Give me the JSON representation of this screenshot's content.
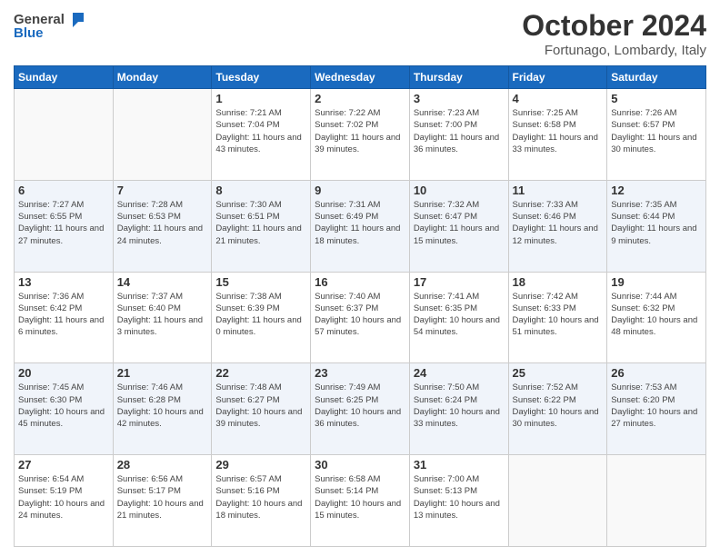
{
  "logo": {
    "general": "General",
    "blue": "Blue"
  },
  "title": "October 2024",
  "subtitle": "Fortunago, Lombardy, Italy",
  "weekdays": [
    "Sunday",
    "Monday",
    "Tuesday",
    "Wednesday",
    "Thursday",
    "Friday",
    "Saturday"
  ],
  "weeks": [
    [
      {
        "day": "",
        "info": ""
      },
      {
        "day": "",
        "info": ""
      },
      {
        "day": "1",
        "sunrise": "Sunrise: 7:21 AM",
        "sunset": "Sunset: 7:04 PM",
        "daylight": "Daylight: 11 hours and 43 minutes."
      },
      {
        "day": "2",
        "sunrise": "Sunrise: 7:22 AM",
        "sunset": "Sunset: 7:02 PM",
        "daylight": "Daylight: 11 hours and 39 minutes."
      },
      {
        "day": "3",
        "sunrise": "Sunrise: 7:23 AM",
        "sunset": "Sunset: 7:00 PM",
        "daylight": "Daylight: 11 hours and 36 minutes."
      },
      {
        "day": "4",
        "sunrise": "Sunrise: 7:25 AM",
        "sunset": "Sunset: 6:58 PM",
        "daylight": "Daylight: 11 hours and 33 minutes."
      },
      {
        "day": "5",
        "sunrise": "Sunrise: 7:26 AM",
        "sunset": "Sunset: 6:57 PM",
        "daylight": "Daylight: 11 hours and 30 minutes."
      }
    ],
    [
      {
        "day": "6",
        "sunrise": "Sunrise: 7:27 AM",
        "sunset": "Sunset: 6:55 PM",
        "daylight": "Daylight: 11 hours and 27 minutes."
      },
      {
        "day": "7",
        "sunrise": "Sunrise: 7:28 AM",
        "sunset": "Sunset: 6:53 PM",
        "daylight": "Daylight: 11 hours and 24 minutes."
      },
      {
        "day": "8",
        "sunrise": "Sunrise: 7:30 AM",
        "sunset": "Sunset: 6:51 PM",
        "daylight": "Daylight: 11 hours and 21 minutes."
      },
      {
        "day": "9",
        "sunrise": "Sunrise: 7:31 AM",
        "sunset": "Sunset: 6:49 PM",
        "daylight": "Daylight: 11 hours and 18 minutes."
      },
      {
        "day": "10",
        "sunrise": "Sunrise: 7:32 AM",
        "sunset": "Sunset: 6:47 PM",
        "daylight": "Daylight: 11 hours and 15 minutes."
      },
      {
        "day": "11",
        "sunrise": "Sunrise: 7:33 AM",
        "sunset": "Sunset: 6:46 PM",
        "daylight": "Daylight: 11 hours and 12 minutes."
      },
      {
        "day": "12",
        "sunrise": "Sunrise: 7:35 AM",
        "sunset": "Sunset: 6:44 PM",
        "daylight": "Daylight: 11 hours and 9 minutes."
      }
    ],
    [
      {
        "day": "13",
        "sunrise": "Sunrise: 7:36 AM",
        "sunset": "Sunset: 6:42 PM",
        "daylight": "Daylight: 11 hours and 6 minutes."
      },
      {
        "day": "14",
        "sunrise": "Sunrise: 7:37 AM",
        "sunset": "Sunset: 6:40 PM",
        "daylight": "Daylight: 11 hours and 3 minutes."
      },
      {
        "day": "15",
        "sunrise": "Sunrise: 7:38 AM",
        "sunset": "Sunset: 6:39 PM",
        "daylight": "Daylight: 11 hours and 0 minutes."
      },
      {
        "day": "16",
        "sunrise": "Sunrise: 7:40 AM",
        "sunset": "Sunset: 6:37 PM",
        "daylight": "Daylight: 10 hours and 57 minutes."
      },
      {
        "day": "17",
        "sunrise": "Sunrise: 7:41 AM",
        "sunset": "Sunset: 6:35 PM",
        "daylight": "Daylight: 10 hours and 54 minutes."
      },
      {
        "day": "18",
        "sunrise": "Sunrise: 7:42 AM",
        "sunset": "Sunset: 6:33 PM",
        "daylight": "Daylight: 10 hours and 51 minutes."
      },
      {
        "day": "19",
        "sunrise": "Sunrise: 7:44 AM",
        "sunset": "Sunset: 6:32 PM",
        "daylight": "Daylight: 10 hours and 48 minutes."
      }
    ],
    [
      {
        "day": "20",
        "sunrise": "Sunrise: 7:45 AM",
        "sunset": "Sunset: 6:30 PM",
        "daylight": "Daylight: 10 hours and 45 minutes."
      },
      {
        "day": "21",
        "sunrise": "Sunrise: 7:46 AM",
        "sunset": "Sunset: 6:28 PM",
        "daylight": "Daylight: 10 hours and 42 minutes."
      },
      {
        "day": "22",
        "sunrise": "Sunrise: 7:48 AM",
        "sunset": "Sunset: 6:27 PM",
        "daylight": "Daylight: 10 hours and 39 minutes."
      },
      {
        "day": "23",
        "sunrise": "Sunrise: 7:49 AM",
        "sunset": "Sunset: 6:25 PM",
        "daylight": "Daylight: 10 hours and 36 minutes."
      },
      {
        "day": "24",
        "sunrise": "Sunrise: 7:50 AM",
        "sunset": "Sunset: 6:24 PM",
        "daylight": "Daylight: 10 hours and 33 minutes."
      },
      {
        "day": "25",
        "sunrise": "Sunrise: 7:52 AM",
        "sunset": "Sunset: 6:22 PM",
        "daylight": "Daylight: 10 hours and 30 minutes."
      },
      {
        "day": "26",
        "sunrise": "Sunrise: 7:53 AM",
        "sunset": "Sunset: 6:20 PM",
        "daylight": "Daylight: 10 hours and 27 minutes."
      }
    ],
    [
      {
        "day": "27",
        "sunrise": "Sunrise: 6:54 AM",
        "sunset": "Sunset: 5:19 PM",
        "daylight": "Daylight: 10 hours and 24 minutes."
      },
      {
        "day": "28",
        "sunrise": "Sunrise: 6:56 AM",
        "sunset": "Sunset: 5:17 PM",
        "daylight": "Daylight: 10 hours and 21 minutes."
      },
      {
        "day": "29",
        "sunrise": "Sunrise: 6:57 AM",
        "sunset": "Sunset: 5:16 PM",
        "daylight": "Daylight: 10 hours and 18 minutes."
      },
      {
        "day": "30",
        "sunrise": "Sunrise: 6:58 AM",
        "sunset": "Sunset: 5:14 PM",
        "daylight": "Daylight: 10 hours and 15 minutes."
      },
      {
        "day": "31",
        "sunrise": "Sunrise: 7:00 AM",
        "sunset": "Sunset: 5:13 PM",
        "daylight": "Daylight: 10 hours and 13 minutes."
      },
      {
        "day": "",
        "info": ""
      },
      {
        "day": "",
        "info": ""
      }
    ]
  ]
}
